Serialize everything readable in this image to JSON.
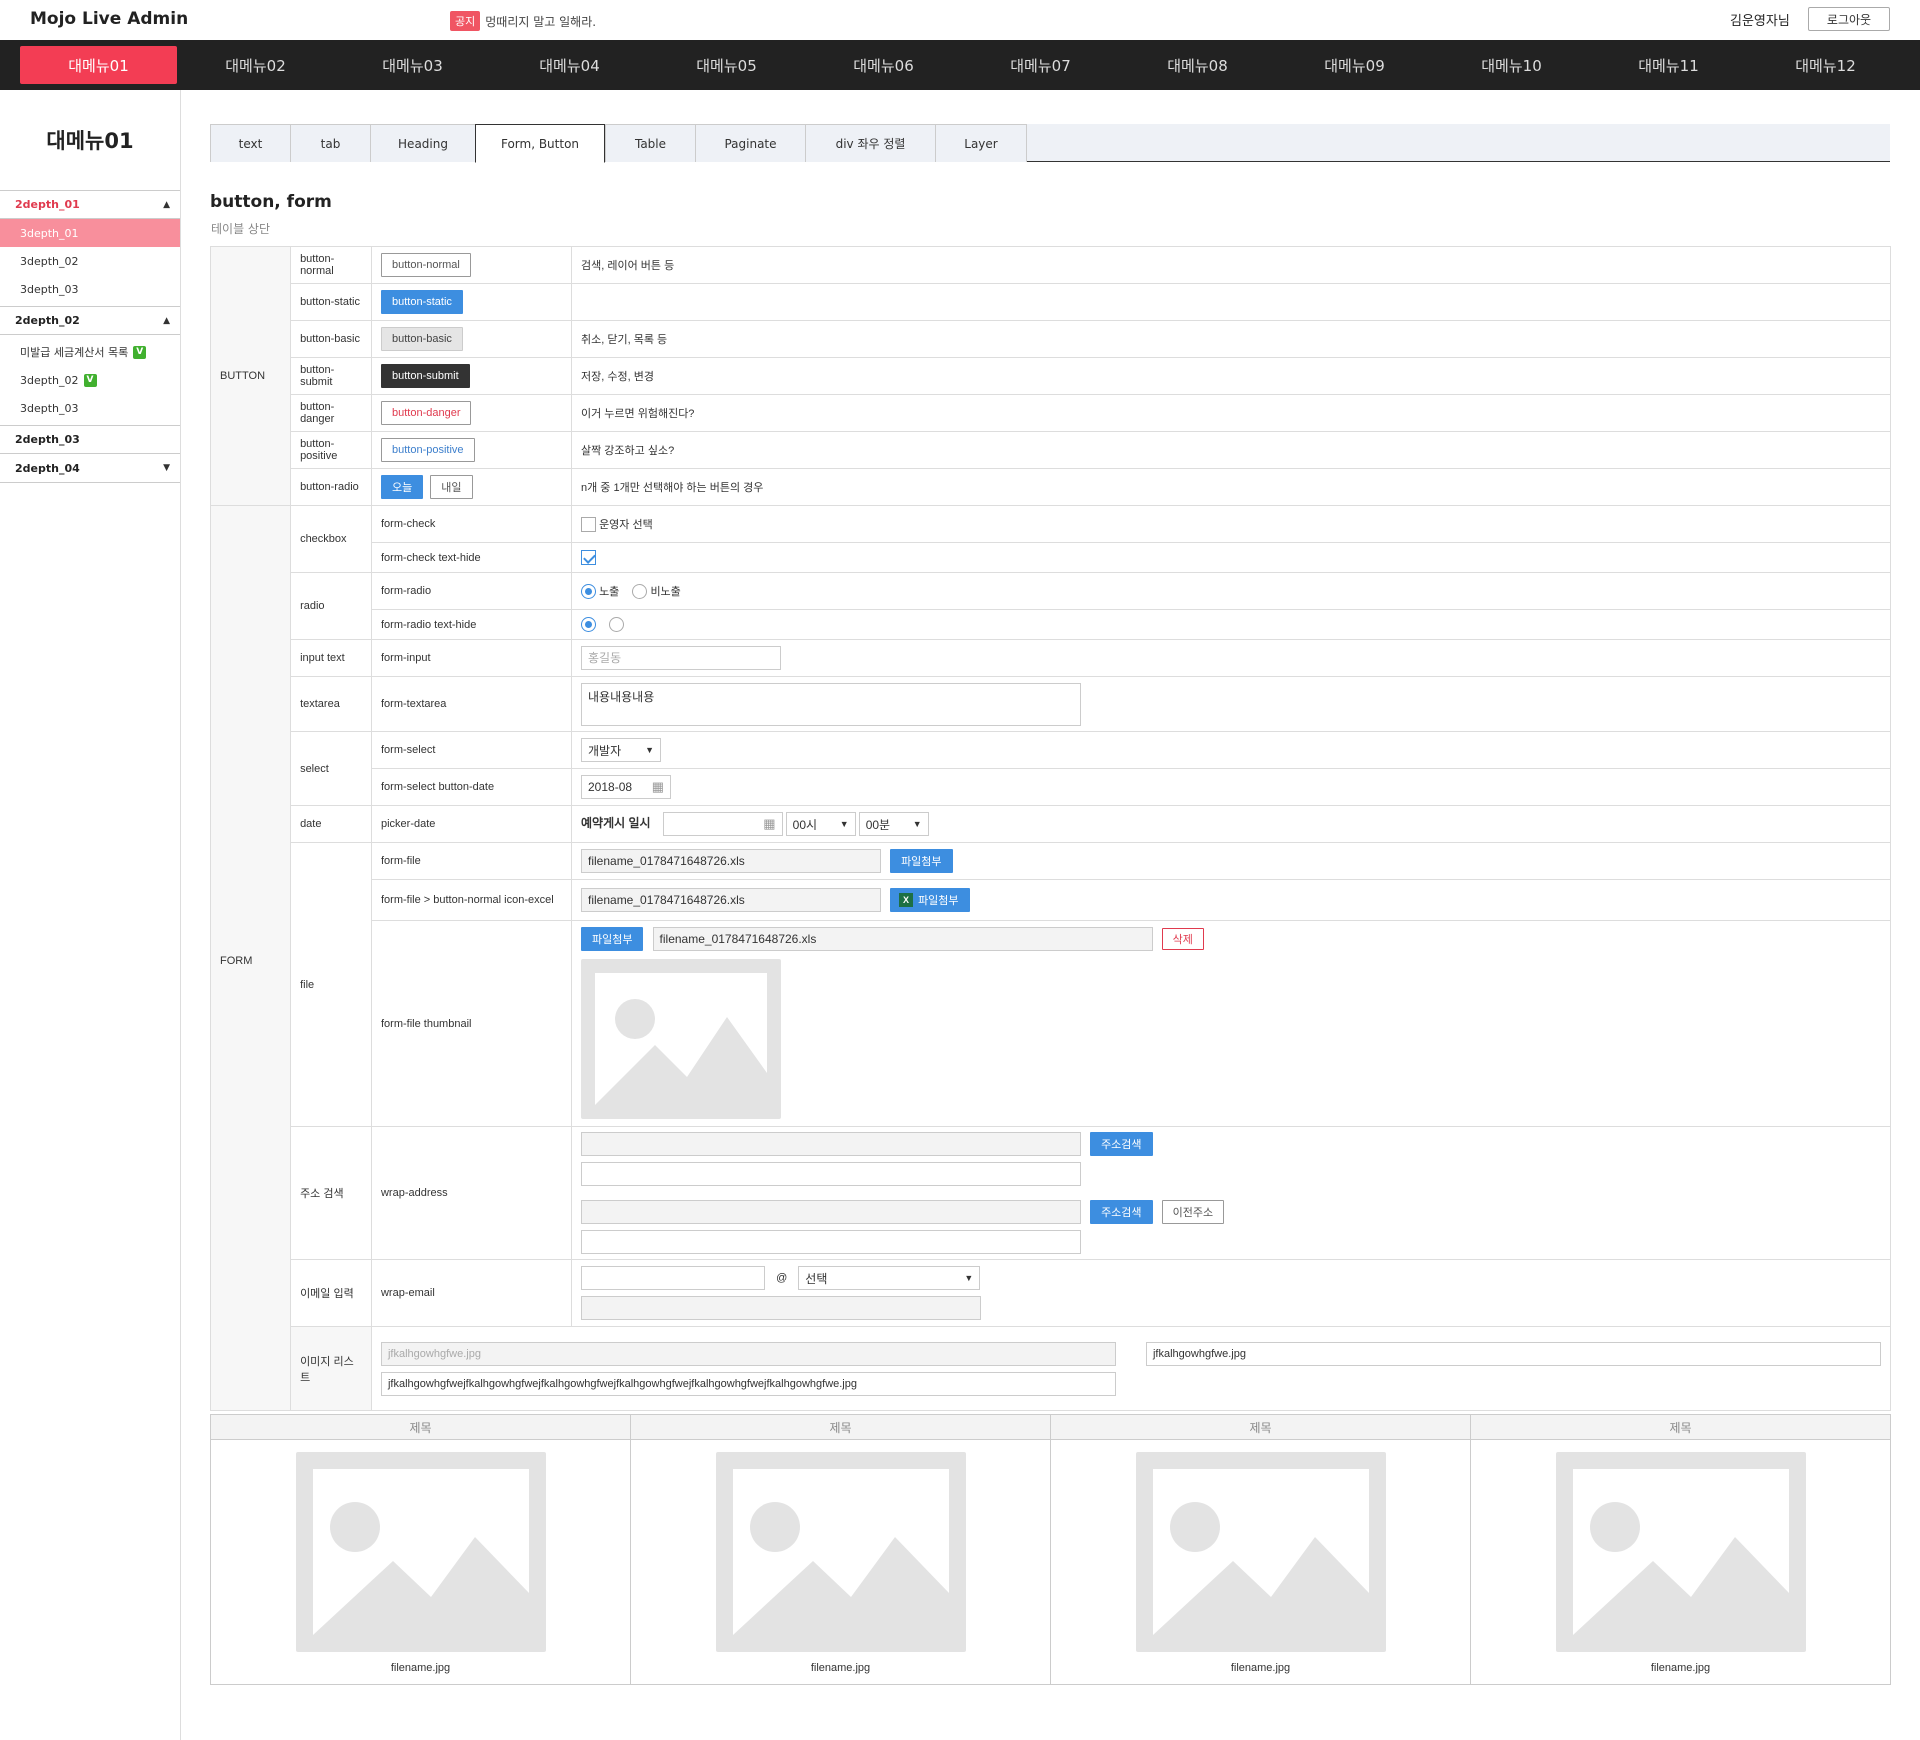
{
  "header": {
    "logo": "Mojo Live Admin",
    "notice_badge": "공지",
    "notice_text": "멍때리지 말고 일해라.",
    "user": "김운영자님",
    "logout": "로그아웃"
  },
  "gnb": [
    "대메뉴01",
    "대메뉴02",
    "대메뉴03",
    "대메뉴04",
    "대메뉴05",
    "대메뉴06",
    "대메뉴07",
    "대메뉴08",
    "대메뉴09",
    "대메뉴10",
    "대메뉴11",
    "대메뉴12"
  ],
  "lnb": {
    "title": "대메뉴01",
    "d2_1": "2depth_01",
    "d2_1_items": [
      "3depth_01",
      "3depth_02",
      "3depth_03"
    ],
    "d2_2": "2depth_02",
    "d2_2_items": [
      "미발급 세금계산서 목록",
      "3depth_02",
      "3depth_03"
    ],
    "v_badge": "V",
    "d2_3": "2depth_03",
    "d2_4": "2depth_04"
  },
  "tabs": [
    "text",
    "tab",
    "Heading",
    "Form, Button",
    "Table",
    "Paginate",
    "div 좌우 정렬",
    "Layer"
  ],
  "section": {
    "title": "button, form",
    "subtitle": "테이블 상단"
  },
  "button_group": "BUTTON",
  "form_group": "FORM",
  "buttons": [
    {
      "name": "button-normal",
      "desc": "검색, 레이어 버튼 등"
    },
    {
      "name": "button-static",
      "desc": ""
    },
    {
      "name": "button-basic",
      "desc": "취소, 닫기, 목록 등"
    },
    {
      "name": "button-submit",
      "desc": "저장, 수정, 변경"
    },
    {
      "name": "button-danger",
      "desc": "이거 누르면 위험해진다?"
    },
    {
      "name": "button-positive",
      "desc": "살짝 강조하고 싶소?"
    },
    {
      "name": "button-radio",
      "desc": "n개 중 1개만 선택해야 하는 버튼의 경우"
    }
  ],
  "radio_btns": {
    "today": "오늘",
    "tomorrow": "내일"
  },
  "form": {
    "checkbox": "checkbox",
    "form_check": "form-check",
    "form_check_label": "운영자 선택",
    "form_check_hide": "form-check text-hide",
    "radio": "radio",
    "form_radio": "form-radio",
    "radio_opt1": "노출",
    "radio_opt2": "비노출",
    "form_radio_hide": "form-radio text-hide",
    "input_text": "input text",
    "form_input": "form-input",
    "input_placeholder": "홍길동",
    "textarea": "textarea",
    "form_textarea": "form-textarea",
    "textarea_value": "내용내용내용",
    "select": "select",
    "form_select": "form-select",
    "select_value": "개발자",
    "form_select_date": "form-select button-date",
    "date_value": "2018-08",
    "date": "date",
    "picker_date": "picker-date",
    "picker_label": "예약게시 일시",
    "hour": "00시",
    "minute": "00분",
    "file": "file",
    "form_file": "form-file",
    "filename": "filename_0178471648726.xls",
    "attach": "파일첨부",
    "form_file_excel": "form-file > button-normal icon-excel",
    "form_file_thumb": "form-file thumbnail",
    "delete": "삭제",
    "address": "주소 검색",
    "wrap_address": "wrap-address",
    "addr_search": "주소검색",
    "addr_prev": "이전주소",
    "email": "이메일 입력",
    "wrap_email": "wrap-email",
    "at": "@",
    "email_select": "선택"
  },
  "image_list": {
    "label": "이미지 리스트",
    "file1": "jfkalhgowhgfwe.jpg",
    "file2": "jfkalhgowhgfwe.jpg",
    "file3": "jfkalhgowhgfwejfkalhgowhgfwejfkalhgowhgfwejfkalhgowhgfwejfkalhgowhgfwejfkalhgowhgfwe.jpg"
  },
  "gallery": {
    "header": [
      "제목",
      "제목",
      "제목",
      "제목"
    ],
    "captions": [
      "filename.jpg",
      "filename.jpg",
      "filename.jpg",
      "filename.jpg"
    ]
  },
  "colors": {
    "accent": "#f33d54",
    "blue": "#3d8ee0",
    "dark": "#222222"
  }
}
